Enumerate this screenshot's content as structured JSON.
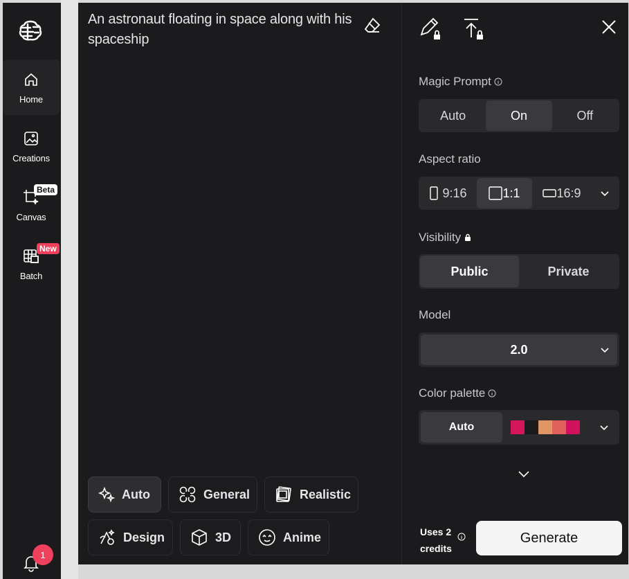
{
  "sidebar": {
    "items": [
      {
        "label": "Home",
        "icon": "home-icon"
      },
      {
        "label": "Creations",
        "icon": "image-icon"
      },
      {
        "label": "Canvas",
        "icon": "crop-sparkle-icon",
        "badge": "Beta"
      },
      {
        "label": "Batch",
        "icon": "grid-image-icon",
        "badge": "New"
      }
    ],
    "notifications": "1"
  },
  "prompt": {
    "text": "An astronaut floating in space along with his spaceship"
  },
  "styles": [
    {
      "label": "Auto",
      "icon": "sparkles-icon"
    },
    {
      "label": "General",
      "icon": "general-icon"
    },
    {
      "label": "Realistic",
      "icon": "photos-icon"
    },
    {
      "label": "Design",
      "icon": "design-icon"
    },
    {
      "label": "3D",
      "icon": "cube-icon"
    },
    {
      "label": "Anime",
      "icon": "anime-icon"
    }
  ],
  "settings": {
    "magic_prompt": {
      "label": "Magic Prompt",
      "options": [
        "Auto",
        "On",
        "Off"
      ],
      "selected": "On"
    },
    "aspect_ratio": {
      "label": "Aspect ratio",
      "options": [
        "9:16",
        "1:1",
        "16:9"
      ],
      "selected": "1:1"
    },
    "visibility": {
      "label": "Visibility",
      "options": [
        "Public",
        "Private"
      ],
      "selected": "Public"
    },
    "model": {
      "label": "Model",
      "value": "2.0"
    },
    "color_palette": {
      "label": "Color palette",
      "value": "Auto",
      "swatches": [
        "#d6165c",
        "#1b1b1d",
        "#e39665",
        "#e0605c",
        "#d1105e"
      ]
    }
  },
  "footer": {
    "credits": "Uses 2 credits",
    "generate": "Generate"
  },
  "colors": {
    "accent": "#f0415c",
    "panel": "#1b1b1d",
    "control": "#2a2a2d"
  }
}
